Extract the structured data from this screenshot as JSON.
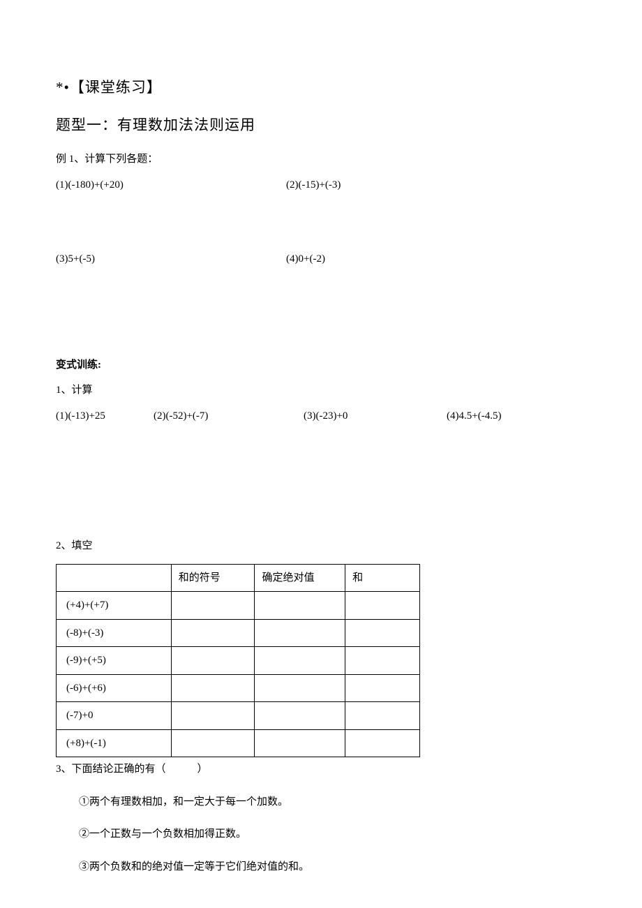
{
  "heading1": "*•【课堂练习】",
  "heading2": "题型一：有理数加法法则运用",
  "example1": {
    "title": "例 1、计算下列各题：",
    "items": [
      "(1)(-180)+(+20)",
      "(2)(-15)+(-3)",
      "(3)5+(-5)",
      "(4)0+(-2)"
    ]
  },
  "variation": {
    "title": "变式训练:",
    "q1": {
      "title": "1、计算",
      "items": [
        "(1)(-13)+25",
        "(2)(-52)+(-7)",
        "(3)(-23)+0",
        "(4)4.5+(-4.5)"
      ]
    },
    "q2": {
      "title": "2、填空",
      "headers": [
        "",
        "和的符号",
        "确定绝对值",
        "和"
      ],
      "rows": [
        "(+4)+(+7)",
        "(-8)+(-3)",
        "(-9)+(+5)",
        "(-6)+(+6)",
        "(-7)+0",
        "(+8)+(-1)"
      ]
    },
    "q3": {
      "title": "3、下面结论正确的有（　　　）",
      "statements": [
        "①两个有理数相加，和一定大于每一个加数。",
        "②一个正数与一个负数相加得正数。",
        "③两个负数和的绝对值一定等于它们绝对值的和。"
      ]
    }
  }
}
